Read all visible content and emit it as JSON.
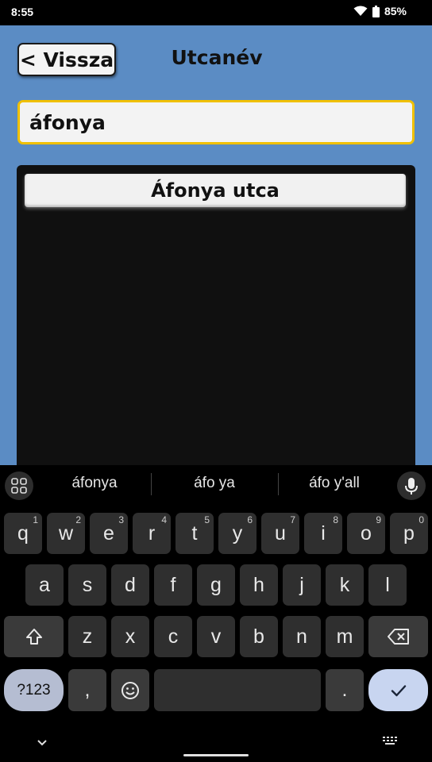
{
  "status": {
    "time": "8:55",
    "battery": "85%"
  },
  "header": {
    "back_label": "< Vissza",
    "title": "Utcanév"
  },
  "search": {
    "value": "áfonya"
  },
  "results": {
    "items": [
      "Áfonya utca"
    ]
  },
  "keyboard": {
    "suggestions": [
      "áfonya",
      "áfo ya",
      "áfo y'all"
    ],
    "row1": [
      {
        "k": "q",
        "n": "1"
      },
      {
        "k": "w",
        "n": "2"
      },
      {
        "k": "e",
        "n": "3"
      },
      {
        "k": "r",
        "n": "4"
      },
      {
        "k": "t",
        "n": "5"
      },
      {
        "k": "y",
        "n": "6"
      },
      {
        "k": "u",
        "n": "7"
      },
      {
        "k": "i",
        "n": "8"
      },
      {
        "k": "o",
        "n": "9"
      },
      {
        "k": "p",
        "n": "0"
      }
    ],
    "row2": [
      "a",
      "s",
      "d",
      "f",
      "g",
      "h",
      "j",
      "k",
      "l"
    ],
    "row3": [
      "z",
      "x",
      "c",
      "v",
      "b",
      "n",
      "m"
    ],
    "symbols_label": "?123",
    "comma": ",",
    "period": "."
  },
  "colors": {
    "app_bg": "#5b8cc4",
    "focus_border": "#f0c000",
    "enter_key": "#c8d5f0"
  }
}
